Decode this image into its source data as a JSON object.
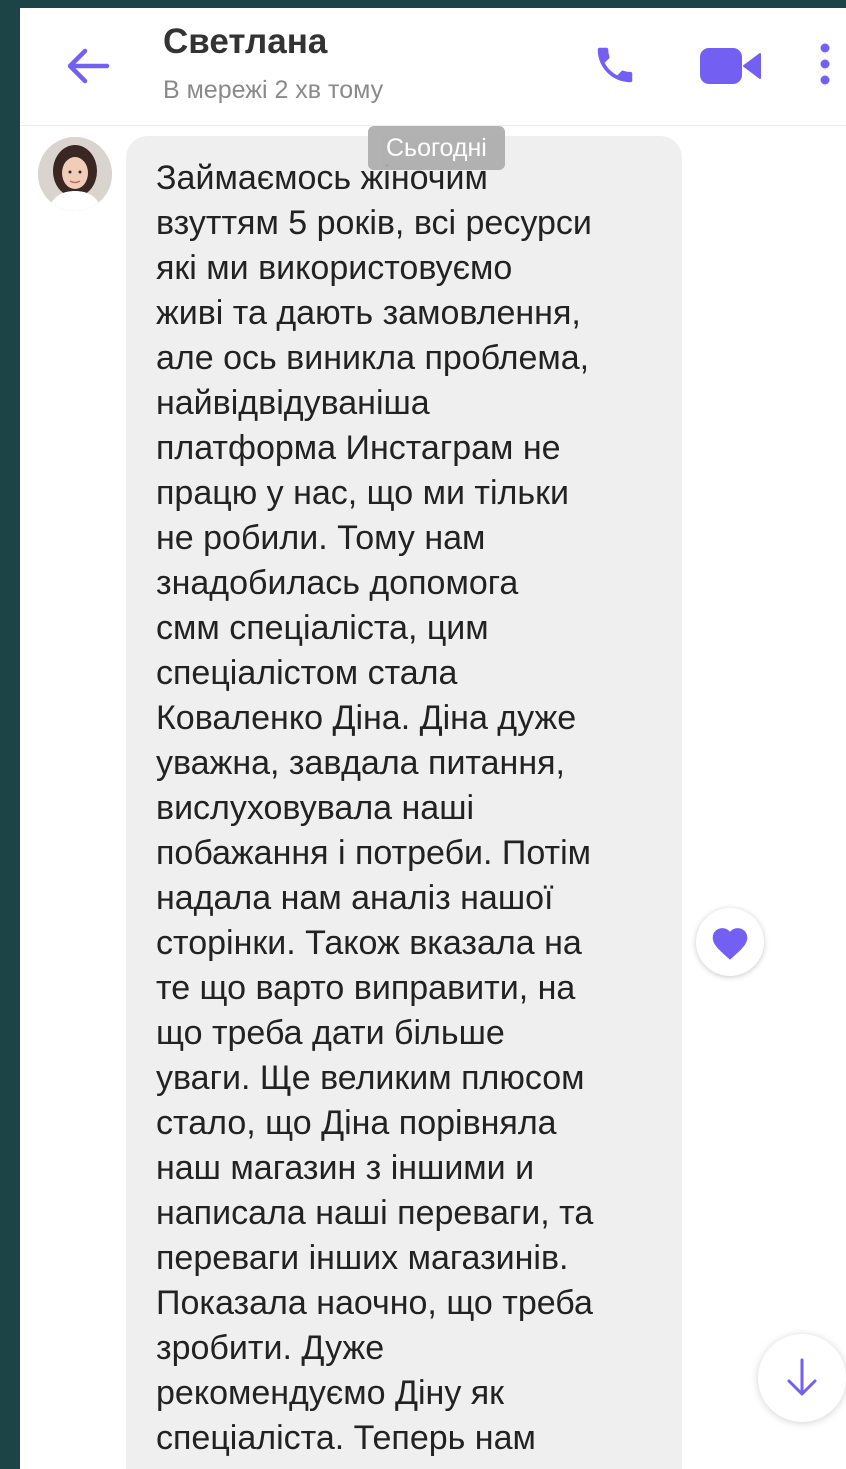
{
  "header": {
    "contact_name": "Светлана",
    "status": "В мережі 2 хв тому"
  },
  "conversation": {
    "date_separator": "Сьогодні",
    "message": {
      "text": "Займаємось жіночим\nвзуттям 5 років, всі ресурси\nякі ми використовуємо\nживі та дають замовлення,\nале ось виникла проблема,\nнайвідвідуваніша\nплатформа Инстаграм не\nпрацю у нас, що ми тільки\nне робили. Тому нам\nзнадобилась допомога\nсмм спеціаліста, цим\nспеціалістом стала\nКоваленко Діна. Діна дуже\nуважна, завдала питання,\nвислуховувала наші\nпобажання і потреби. Потім\nнадала нам аналіз нашої\nсторінки. Також вказала на\nте що варто виправити, на\nщо треба дати більше\nуваги. Ще великим плюсом\nстало, що Діна порівняла\nнаш магазин з іншими и\nнаписала наші переваги, та\nпереваги інших магазинів.\nПоказала наочно, що треба\nзробити. Дуже\nрекомендуємо Діну як\nспеціаліста. Теперь нам"
    }
  },
  "icons": {
    "back": "arrow-left-icon",
    "call": "phone-icon",
    "video": "video-camera-icon",
    "more": "more-vertical-icon",
    "like": "heart-icon",
    "scroll": "arrow-down-icon"
  },
  "colors": {
    "accent": "#7360f2",
    "background": "#1c4447",
    "bubble": "#efefef",
    "date_pill": "#aeaeae"
  }
}
